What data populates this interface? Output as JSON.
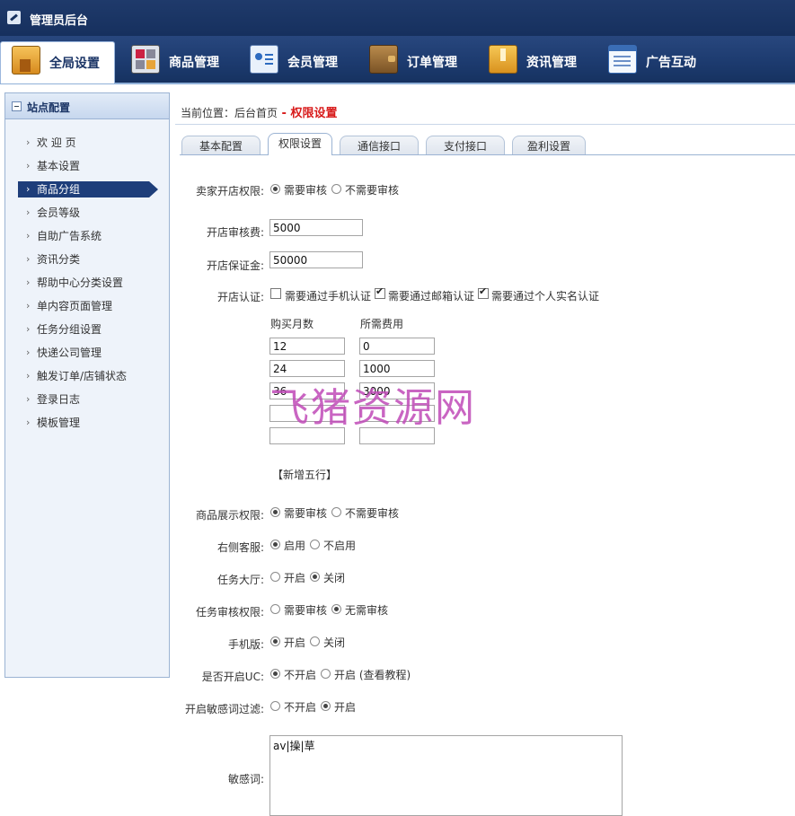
{
  "header": {
    "title": "管理员后台"
  },
  "nav": [
    {
      "label": "全局设置",
      "icon": "home-panel-icon",
      "active": true
    },
    {
      "label": "商品管理",
      "icon": "grid-icon"
    },
    {
      "label": "会员管理",
      "icon": "member-card-icon"
    },
    {
      "label": "订单管理",
      "icon": "wallet-icon"
    },
    {
      "label": "资讯管理",
      "icon": "news-icon"
    },
    {
      "label": "广告互动",
      "icon": "ad-window-icon"
    }
  ],
  "sidebar": {
    "title": "站点配置",
    "items": [
      {
        "label": "欢 迎 页"
      },
      {
        "label": "基本设置"
      },
      {
        "label": "商品分组",
        "active": true
      },
      {
        "label": "会员等级"
      },
      {
        "label": "自助广告系统"
      },
      {
        "label": "资讯分类"
      },
      {
        "label": "帮助中心分类设置"
      },
      {
        "label": "单内容页面管理"
      },
      {
        "label": "任务分组设置"
      },
      {
        "label": "快递公司管理"
      },
      {
        "label": "触发订单/店铺状态"
      },
      {
        "label": "登录日志"
      },
      {
        "label": "模板管理"
      }
    ]
  },
  "breadcrumb": {
    "prefix": "当前位置：",
    "home": "后台首页",
    "sep": " - ",
    "current": "权限设置"
  },
  "tabs": [
    {
      "label": "基本配置"
    },
    {
      "label": "权限设置",
      "active": true
    },
    {
      "label": "通信接口"
    },
    {
      "label": "支付接口"
    },
    {
      "label": "盈利设置"
    }
  ],
  "form": {
    "shop_open": {
      "label": "卖家开店权限:",
      "opt1": "需要审核",
      "opt2": "不需要审核",
      "selected": 1
    },
    "audit_fee": {
      "label": "开店审核费:",
      "value": "5000"
    },
    "deposit": {
      "label": "开店保证金:",
      "value": "50000"
    },
    "certify": {
      "label": "开店认证:",
      "opt1": "需要通过手机认证",
      "opt1_checked": false,
      "opt2": "需要通过邮箱认证",
      "opt2_checked": true,
      "opt3": "需要通过个人实名认证",
      "opt3_checked": true
    },
    "fee_table": {
      "col_months": "购买月数",
      "col_fee": "所需费用",
      "rows": [
        {
          "months": "12",
          "fee": "0"
        },
        {
          "months": "24",
          "fee": "1000"
        },
        {
          "months": "36",
          "fee": "3000"
        },
        {
          "months": "",
          "fee": ""
        },
        {
          "months": "",
          "fee": ""
        }
      ],
      "add_label": "【新增五行】"
    },
    "goods_show": {
      "label": "商品展示权限:",
      "opt1": "需要审核",
      "opt2": "不需要审核",
      "selected": 1
    },
    "service": {
      "label": "右侧客服:",
      "opt1": "启用",
      "opt2": "不启用",
      "selected": 1
    },
    "task_hall": {
      "label": "任务大厅:",
      "opt1": "开启",
      "opt2": "关闭",
      "selected": 2
    },
    "task_audit": {
      "label": "任务审核权限:",
      "opt1": "需要审核",
      "opt2": "无需审核",
      "selected": 2
    },
    "mobile": {
      "label": "手机版:",
      "opt1": "开启",
      "opt2": "关闭",
      "selected": 1
    },
    "uc": {
      "label": "是否开启UC:",
      "opt1": "不开启",
      "opt2": "开启 (查看教程)",
      "selected": 1
    },
    "word_filter": {
      "label": "开启敏感词过滤:",
      "opt1": "不开启",
      "opt2": "开启",
      "selected": 2
    },
    "sensitive": {
      "label": "敏感词:",
      "value": "av|操|草"
    }
  },
  "watermark": "飞猪资源网"
}
